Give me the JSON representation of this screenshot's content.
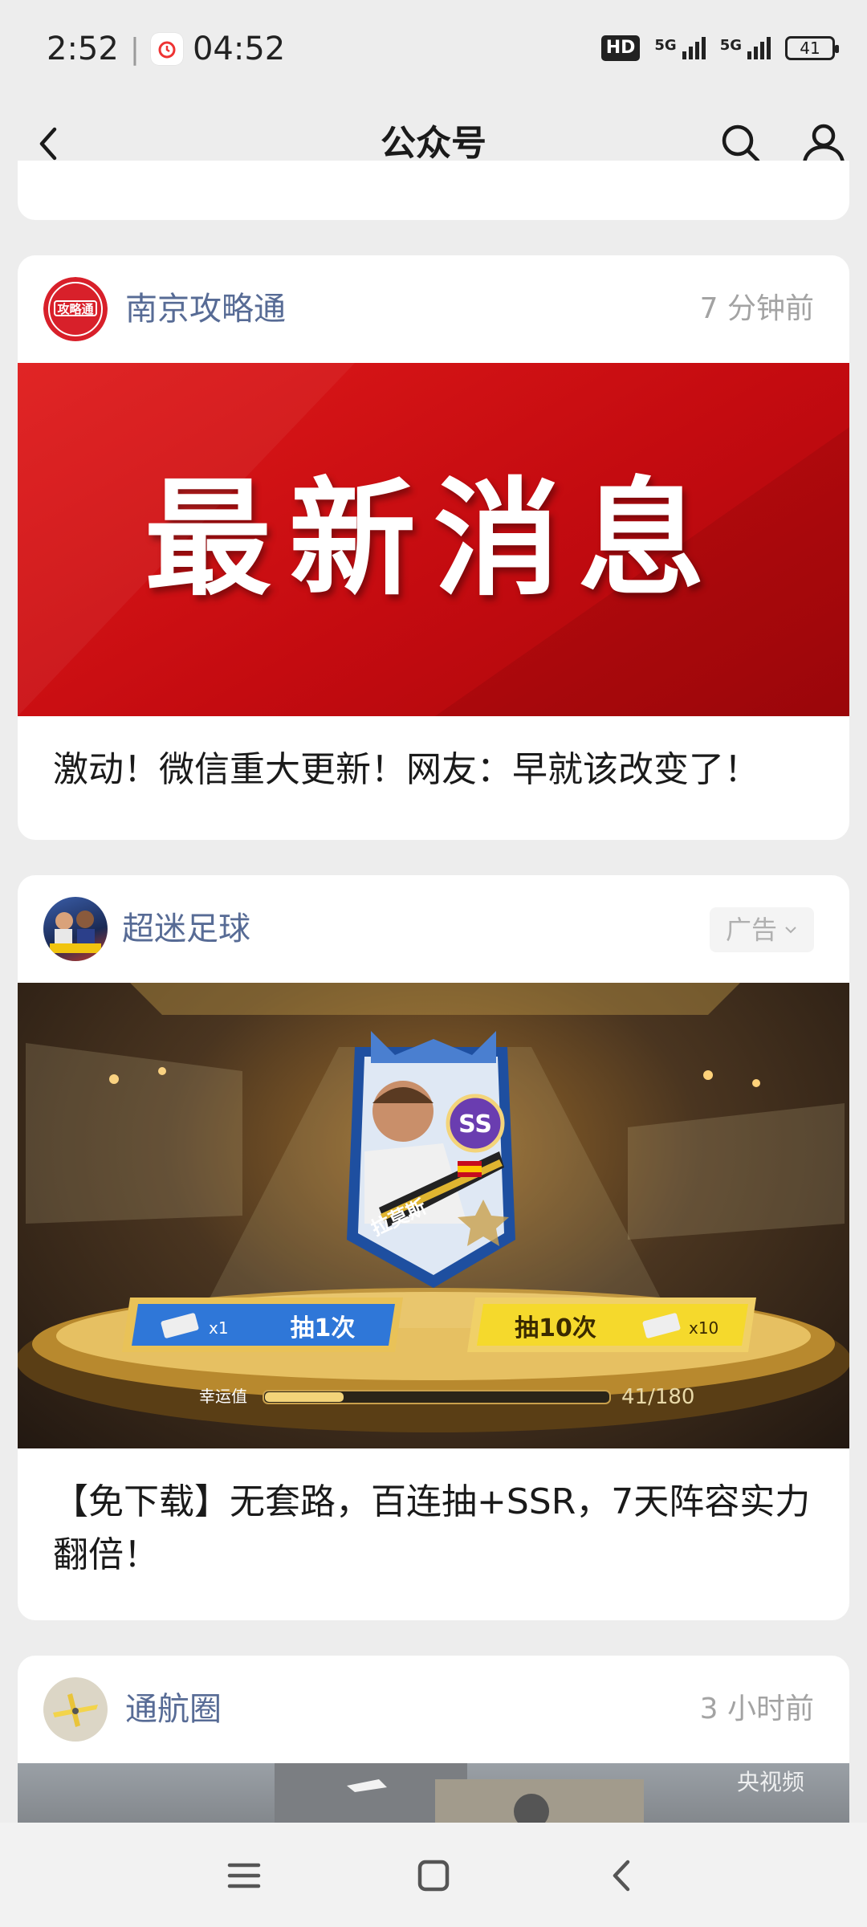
{
  "status_bar": {
    "time": "2:52",
    "alarm_time": "04:52",
    "battery": "41",
    "hd": "HD",
    "net1": "5G",
    "net2": "5G"
  },
  "header": {
    "title": "公众号"
  },
  "cards": [
    {
      "account": "南京攻略通",
      "time": "7 分钟前",
      "cover_text": "最新消息",
      "avatar_text": "攻略通",
      "title": "激动！微信重大更新！网友：早就该改变了！"
    },
    {
      "account": "超迷足球",
      "ad_label": "广告",
      "title": "【免下载】无套路，百连抽+SSR，7天阵容实力翻倍！",
      "game": {
        "draw1": "抽1次",
        "draw10": "抽10次",
        "x1": "x1",
        "x10": "x10",
        "luck_label": "幸运值",
        "luck_value": "41/180",
        "luck_progress": 0.23,
        "player_name": "拉莫斯",
        "rank": "SS"
      }
    },
    {
      "account": "通航圈",
      "time": "3 小时前",
      "watermark": "央视频"
    }
  ],
  "icons": {
    "back": "back-arrow-icon",
    "search": "search-icon",
    "profile": "profile-icon",
    "menu": "menu-icon",
    "home": "home-icon",
    "nav_back": "nav-back-icon"
  }
}
